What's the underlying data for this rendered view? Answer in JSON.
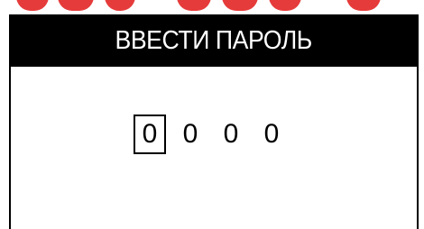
{
  "colors": {
    "background": "#ffffff",
    "title_bar": "#000000",
    "title_text": "#ffffff",
    "border": "#000000",
    "top_strip_accent": "#e63b3b"
  },
  "header": {
    "title": "ВВЕСТИ ПАРОЛЬ"
  },
  "password": {
    "digits": [
      "0",
      "0",
      "0",
      "0"
    ],
    "selected_index": 0
  }
}
